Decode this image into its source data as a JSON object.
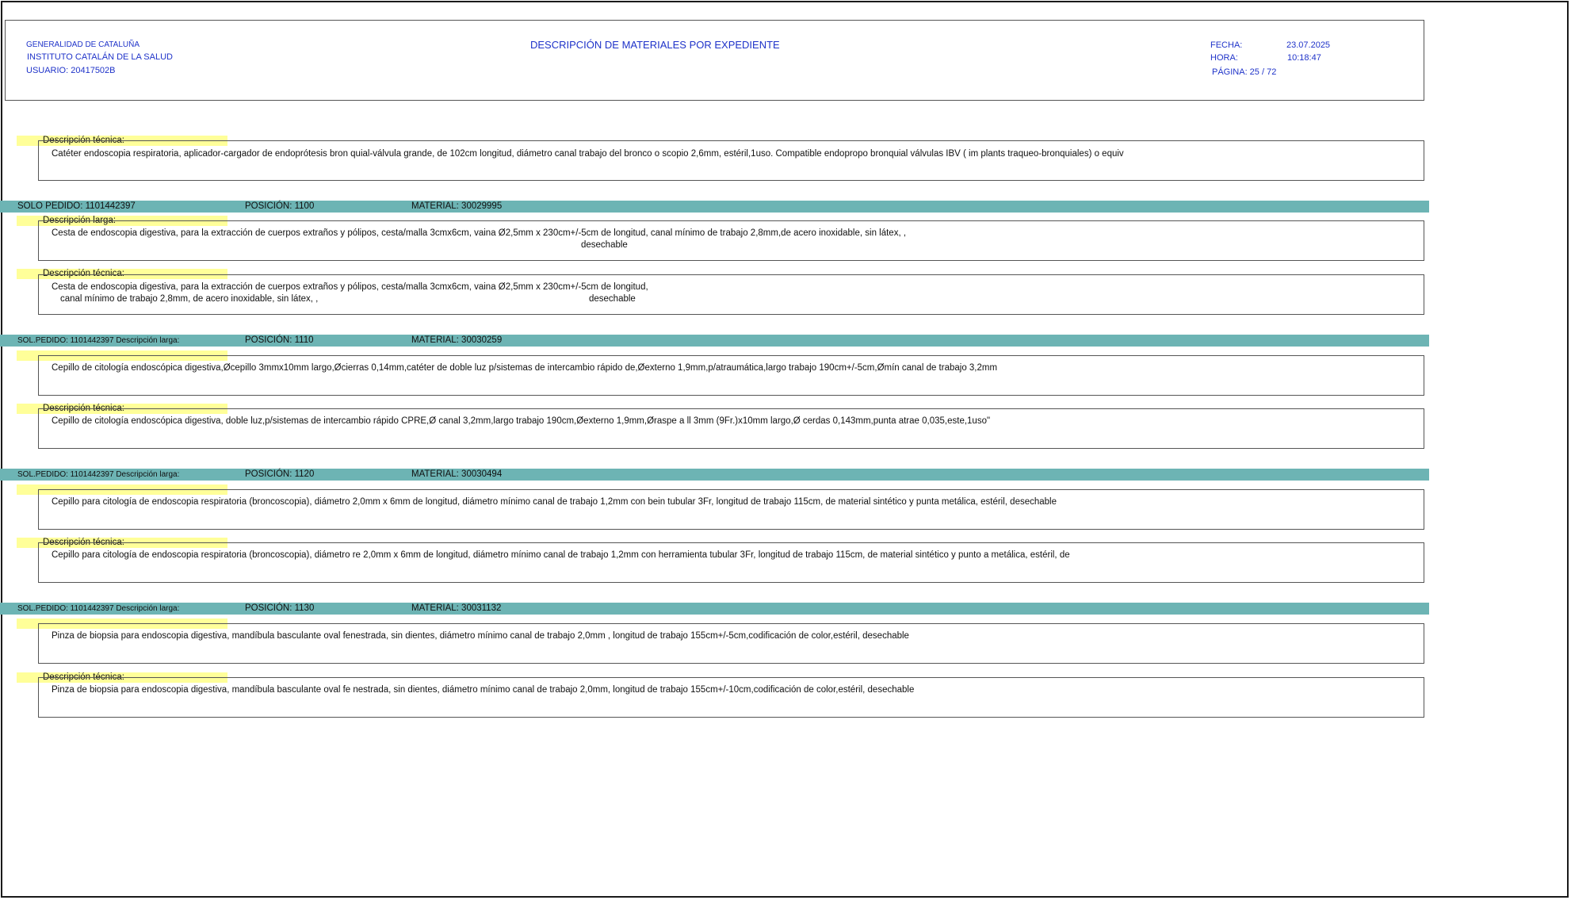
{
  "header": {
    "org_line1": "GENERALIDAD DE CATALUÑA",
    "org_line2": "INSTITUTO CATALÁN DE LA SALUD",
    "user": "USUARIO: 20417502B",
    "title": "DESCRIPCIÓN DE MATERIALES POR EXPEDIENTE",
    "date_label": "FECHA:",
    "date_value": "23.07.2025",
    "time_label": "HORA:",
    "time_value": "10:18:47",
    "page_label": "PÁGINA: 25 / 72"
  },
  "top_block": {
    "tech_label": "Descripción técnica:",
    "tech_text": "Catéter endoscopia respiratoria, aplicador-cargador de endoprótesis bron quial-válvula grande, de 102cm longitud, diámetro canal trabajo del bronco o scopio 2,6mm, estéril,1uso. Compatible endopropo bronquial válvulas IBV ( im plants traqueo-bronquiales) o equiv"
  },
  "items": [
    {
      "solo": "SOLO PEDIDO: 1101442397",
      "position": "POSICIÓN: 1100",
      "material": "MATERIAL: 30029995",
      "long_label": "Descripción larga:",
      "long_line1": "Cesta de endoscopia digestiva, para la extracción de cuerpos extraños y pólipos, cesta/malla 3cmx6cm, vaina Ø2,5mm x 230cm+/-5cm de longitud, canal mínimo de trabajo 2,8mm,de acero inoxidable, sin látex, ,",
      "long_line2": "desechable",
      "tech_label": "Descripción técnica:",
      "tech_line1": "Cesta de endoscopia digestiva, para la extracción de cuerpos extraños y pólipos, cesta/malla 3cmx6cm, vaina Ø2,5mm x 230cm+/-5cm de longitud,",
      "tech_line2a": "canal mínimo de trabajo 2,8mm, de acero inoxidable, sin látex, ,",
      "tech_line2b": "desechable"
    },
    {
      "solo": "SOL.PEDIDO: 1101442397 Descripción larga:",
      "position": "POSICIÓN: 1110",
      "material": "MATERIAL: 30030259",
      "long_text": "Cepillo de citología endoscópica digestiva,Øcepillo 3mmx10mm largo,Øcierras 0,14mm,catéter de doble luz p/sistemas de intercambio rápido de,Øexterno 1,9mm,p/atraumática,largo trabajo 190cm+/-5cm,Ømín canal de trabajo 3,2mm",
      "tech_label": "Descripción técnica:",
      "tech_text": "Cepillo de citología endoscópica digestiva, doble luz,p/sistemas de intercambio rápido CPRE,Ø canal 3,2mm,largo trabajo 190cm,Øexterno 1,9mm,Øraspe a ll 3mm (9Fr.)x10mm largo,Ø cerdas 0,143mm,punta atrae 0,035,este,1uso\""
    },
    {
      "solo": "SOL.PEDIDO: 1101442397 Descripción larga:",
      "position": "POSICIÓN: 1120",
      "material": "MATERIAL: 30030494",
      "long_text": "Cepillo para citología de endoscopia respiratoria (broncoscopia), diámetro 2,0mm x 6mm de longitud, diámetro mínimo canal de trabajo 1,2mm con bein tubular 3Fr, longitud de trabajo 115cm, de material sintético y punta metálica, estéril, desechable",
      "tech_label": "Descripción técnica:",
      "tech_text": "Cepillo para citología de endoscopia respiratoria (broncoscopia), diámetro re 2,0mm x 6mm de longitud, diámetro mínimo canal de trabajo 1,2mm con herramienta tubular 3Fr, longitud de trabajo 115cm, de material sintético y punto a metálica, estéril, de"
    },
    {
      "solo": "SOL.PEDIDO: 1101442397 Descripción larga:",
      "position": "POSICIÓN: 1130",
      "material": "MATERIAL: 30031132",
      "long_text": "Pinza de biopsia para endoscopia digestiva, mandíbula basculante oval fenestrada, sin dientes, diámetro mínimo canal de trabajo 2,0mm , longitud de trabajo 155cm+/-5cm,codificación de color,estéril, desechable",
      "tech_label": "Descripción técnica:",
      "tech_text": "Pinza de biopsia para endoscopia digestiva, mandíbula basculante oval fe nestrada, sin dientes, diámetro mínimo canal de trabajo 2,0mm, longitud de trabajo 155cm+/-10cm,codificación de color,estéril, desechable"
    }
  ],
  "colors": {
    "bar": "#6db4b4",
    "label_highlight": "#ffff99",
    "header_text": "#1f33c9"
  }
}
